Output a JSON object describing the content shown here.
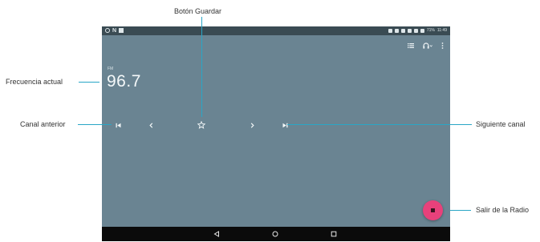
{
  "status_bar": {
    "left_icons": [
      "sync-icon",
      "n-icon",
      "image-icon"
    ],
    "battery": "71%",
    "time": "11:49"
  },
  "toolbar": {
    "icons": [
      "list-icon",
      "headphones-icon",
      "more-vert-icon"
    ]
  },
  "tuner": {
    "band": "FM",
    "frequency": "96.7"
  },
  "controls": {
    "icons": [
      "skip-previous-icon",
      "chevron-left-icon",
      "star-outline-icon",
      "chevron-right-icon",
      "skip-next-icon"
    ]
  },
  "fab": {
    "icon": "stop-icon",
    "color": "#e8417b"
  },
  "nav_bar": {
    "icons": [
      "back-icon",
      "home-icon",
      "recents-icon"
    ]
  },
  "callouts": {
    "save_button": "Botón Guardar",
    "current_frequency": "Frecuencia actual",
    "previous_channel": "Canal anterior",
    "next_channel": "Siguiente canal",
    "exit_radio": "Salir de la Radio"
  },
  "colors": {
    "screen_bg": "#6a8492",
    "status_bar_bg": "#3a4b53",
    "nav_bar_bg": "#0b0b0b",
    "callout_line": "#29a6c6"
  }
}
